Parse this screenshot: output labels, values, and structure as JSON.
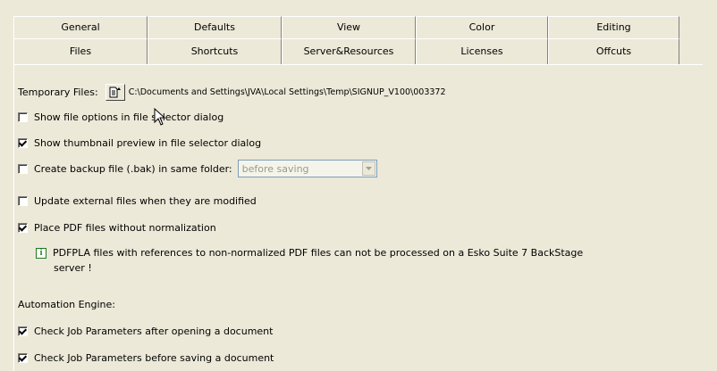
{
  "tabs": {
    "row1": [
      "General",
      "Defaults",
      "View",
      "Color",
      "Editing"
    ],
    "row2": [
      "Files",
      "Shortcuts",
      "Server&Resources",
      "Licenses",
      "Offcuts"
    ]
  },
  "temporary_files": {
    "label": "Temporary Files:",
    "path": "C:\\Documents and Settings\\JVA\\Local Settings\\Temp\\SIGNUP_V100\\003372"
  },
  "options": [
    {
      "label": "Show file options in file selector dialog",
      "checked": false
    },
    {
      "label": "Show thumbnail preview in file selector dialog",
      "checked": true
    },
    {
      "label": "Create backup file (.bak) in same folder:",
      "checked": false
    },
    {
      "label": "Update external files when they are modified",
      "checked": false
    },
    {
      "label": "Place PDF files without normalization",
      "checked": true
    }
  ],
  "backup_select": {
    "value": "before saving"
  },
  "info": {
    "line1": "PDFPLA files with references to non-normalized PDF files can not be processed on a Esko Suite 7 BackStage",
    "line2": "server !"
  },
  "automation": {
    "label": "Automation Engine:",
    "options": [
      {
        "label": "Check Job Parameters after opening a document",
        "checked": true
      },
      {
        "label": "Check Job Parameters before saving a document",
        "checked": true
      }
    ]
  }
}
